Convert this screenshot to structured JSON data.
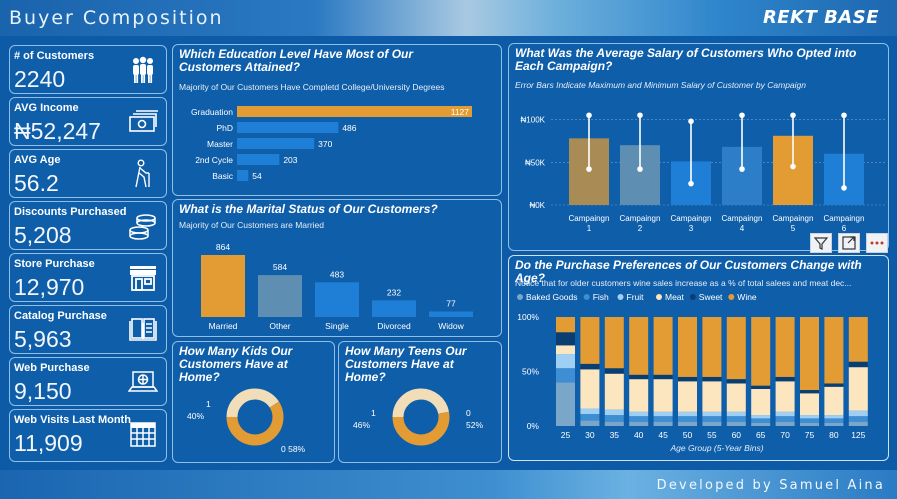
{
  "header": {
    "title": "Buyer Composition",
    "brand": "REKT BASE"
  },
  "footer": {
    "credit": "Developed by Samuel Aina"
  },
  "kpis": [
    {
      "label": "# of Customers",
      "value": "2240",
      "icon": "people-icon"
    },
    {
      "label": "AVG Income",
      "value": "₦52,247",
      "icon": "cash-icon"
    },
    {
      "label": "AVG Age",
      "value": "56.2",
      "icon": "elderly-person-icon"
    },
    {
      "label": "Discounts Purchased",
      "value": "5,208",
      "icon": "coins-icon"
    },
    {
      "label": "Store Purchase",
      "value": "12,970",
      "icon": "store-icon"
    },
    {
      "label": "Catalog Purchase",
      "value": "5,963",
      "icon": "catalog-icon"
    },
    {
      "label": "Web Purchase",
      "value": "9,150",
      "icon": "laptop-globe-icon"
    },
    {
      "label": "Web Visits Last Month",
      "value": "11,909",
      "icon": "calendar-icon"
    }
  ],
  "education": {
    "title": "Which Education Level Have Most of Our Customers Attained?",
    "subtitle": "Majority of  Our Customers Have Completd College/University Degrees"
  },
  "marital": {
    "title": "What is the Marital Status of Our Customers?",
    "subtitle": "Majority of Our Customers are Married"
  },
  "kids": {
    "title": "How Many Kids Our Customers Have at Home?"
  },
  "teens": {
    "title": "How Many Teens Our Customers Have at Home?"
  },
  "salary": {
    "title": "What Was the Average Salary of Customers Who Opted into Each Campaign?",
    "subtitle": "Error Bars Indicate Maximum and Minimum Salary of Customer by Campaign"
  },
  "purchase": {
    "title": "Do the Purchase Preferences of Our Customers Change with Age?",
    "subtitle": "Notice that for older customers wine sales increase as a % of total salees and meat dec..."
  },
  "colors": {
    "orange": "#e39b34",
    "blue": "#1f7fd6",
    "background": "#0d5aa6",
    "cream": "#f1ddb8",
    "olive": "#a88b55",
    "slate": "#5e8fb3"
  },
  "chart_data": [
    {
      "id": "education",
      "type": "bar",
      "orientation": "horizontal",
      "categories": [
        "Graduation",
        "PhD",
        "Master",
        "2nd Cycle",
        "Basic"
      ],
      "values": [
        1127,
        486,
        370,
        203,
        54
      ],
      "highlight": "Graduation"
    },
    {
      "id": "marital",
      "type": "bar",
      "categories": [
        "Married",
        "Other",
        "Single",
        "Divorced",
        "Widow"
      ],
      "values": [
        864,
        584,
        483,
        232,
        77
      ],
      "highlight": "Married"
    },
    {
      "id": "kids",
      "type": "pie",
      "donut": true,
      "slices": [
        {
          "label": "1",
          "percent": "40%",
          "value": 40
        },
        {
          "label": "0",
          "percent": "58%",
          "value": 58
        }
      ]
    },
    {
      "id": "teens",
      "type": "pie",
      "donut": true,
      "slices": [
        {
          "label": "1",
          "percent": "46%",
          "value": 46
        },
        {
          "label": "0",
          "percent": "52%",
          "value": 52
        }
      ]
    },
    {
      "id": "salary",
      "type": "bar",
      "categories": [
        "Campaingn 1",
        "Campaingn 2",
        "Campaingn 3",
        "Campaingn 4",
        "Campaingn 5",
        "Campaingn 6"
      ],
      "values": [
        78000,
        70000,
        51000,
        68000,
        81000,
        60000
      ],
      "min": [
        42000,
        42000,
        25000,
        42000,
        45000,
        20000
      ],
      "max": [
        105000,
        105000,
        98000,
        105000,
        105000,
        105000
      ],
      "yticks": [
        "₦0K",
        "₦50K",
        "₦100K"
      ],
      "ylim": [
        0,
        110000
      ],
      "grid": true
    },
    {
      "id": "purchase",
      "type": "bar",
      "stacked": true,
      "percent": true,
      "xlabel": "Age Group (5-Year Bins)",
      "categories": [
        "25",
        "30",
        "35",
        "40",
        "45",
        "50",
        "55",
        "60",
        "65",
        "70",
        "75",
        "80",
        "125"
      ],
      "legend": [
        "Baked Goods",
        "Fish",
        "Fruit",
        "Meat",
        "Sweet",
        "Wine"
      ],
      "legend_placement": "top",
      "yticks": [
        "0%",
        "50%",
        "100%"
      ],
      "series": [
        {
          "name": "Baked Goods",
          "values": [
            0.4,
            0.05,
            0.04,
            0.04,
            0.04,
            0.04,
            0.04,
            0.04,
            0.03,
            0.04,
            0.03,
            0.03,
            0.04
          ]
        },
        {
          "name": "Fish",
          "values": [
            0.13,
            0.06,
            0.06,
            0.05,
            0.05,
            0.05,
            0.05,
            0.05,
            0.04,
            0.05,
            0.04,
            0.04,
            0.05
          ]
        },
        {
          "name": "Fruit",
          "values": [
            0.13,
            0.05,
            0.05,
            0.04,
            0.04,
            0.04,
            0.04,
            0.04,
            0.03,
            0.04,
            0.03,
            0.03,
            0.05
          ]
        },
        {
          "name": "Meat",
          "values": [
            0.08,
            0.36,
            0.33,
            0.3,
            0.3,
            0.28,
            0.28,
            0.26,
            0.24,
            0.28,
            0.2,
            0.26,
            0.4
          ]
        },
        {
          "name": "Sweet",
          "values": [
            0.12,
            0.05,
            0.05,
            0.04,
            0.04,
            0.04,
            0.04,
            0.04,
            0.03,
            0.04,
            0.03,
            0.03,
            0.05
          ]
        },
        {
          "name": "Wine",
          "values": [
            0.14,
            0.43,
            0.47,
            0.53,
            0.53,
            0.55,
            0.55,
            0.57,
            0.63,
            0.55,
            0.67,
            0.61,
            0.41
          ]
        }
      ]
    }
  ]
}
